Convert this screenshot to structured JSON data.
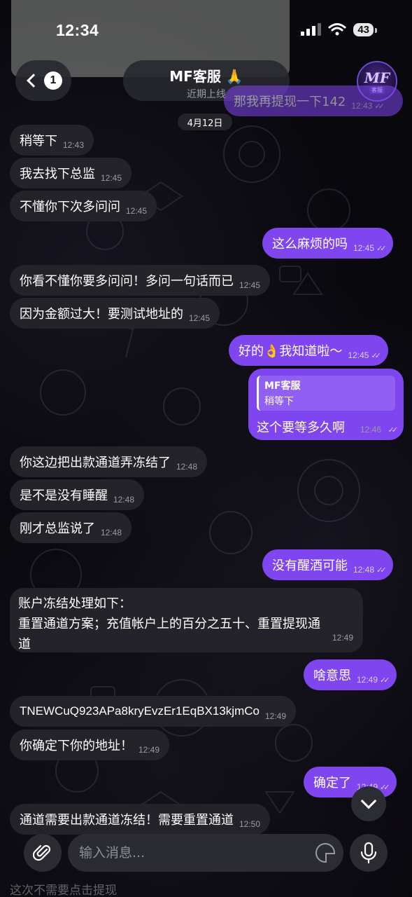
{
  "status_bar": {
    "time": "12:34",
    "battery": "43"
  },
  "header": {
    "back_badge": "1",
    "title": "MF客服 🙏",
    "subtitle": "近期上线",
    "avatar_logo": "MF",
    "avatar_tag": "客服"
  },
  "date_separator": "4月12日",
  "messages": [
    {
      "dir": "out",
      "text": "那我再提现一下142",
      "time": "12:43"
    },
    {
      "dir": "in",
      "text": "稍等下",
      "time": "12:43"
    },
    {
      "dir": "in",
      "text": "我去找下总监",
      "time": "12:45"
    },
    {
      "dir": "in",
      "text": "不懂你下次多问问",
      "time": "12:45"
    },
    {
      "dir": "out",
      "text": "这么麻烦的吗",
      "time": "12:45"
    },
    {
      "dir": "in",
      "text": "你看不懂你要多问问！多问一句话而已",
      "time": "12:45"
    },
    {
      "dir": "in",
      "text": "因为金额过大！要测试地址的",
      "time": "12:45"
    },
    {
      "dir": "out",
      "text": "好的👌我知道啦～",
      "time": "12:45"
    },
    {
      "dir": "out",
      "reply_to_name": "MF客服",
      "reply_to_text": "稍等下",
      "text": "这个要等多久啊",
      "time": "12:46"
    },
    {
      "dir": "in",
      "text": "你这边把出款通道弄冻结了",
      "time": "12:48"
    },
    {
      "dir": "in",
      "text": "是不是没有睡醒",
      "time": "12:48"
    },
    {
      "dir": "in",
      "text": "刚才总监说了",
      "time": "12:48"
    },
    {
      "dir": "out",
      "text": "没有醒酒可能",
      "time": "12:48"
    },
    {
      "dir": "in",
      "text_line1": "账户冻结处理如下：",
      "text_line2": "重置通道方案；充值帐户上的百分之五十、重置提现通",
      "text_line3": "道",
      "time": "12:49"
    },
    {
      "dir": "out",
      "text": "啥意思",
      "time": "12:49"
    },
    {
      "dir": "in",
      "text": "TNEWCuQ923APa8kryEvzEr1EqBX13kjmCo",
      "time": "12:49"
    },
    {
      "dir": "in",
      "text": "你确定下你的地址！",
      "time": "12:49"
    },
    {
      "dir": "out",
      "text": "确定了",
      "time": "12:49"
    },
    {
      "dir": "in",
      "text": "通道需要出款通道冻结！需要重置通道",
      "time": "12:50"
    },
    {
      "dir": "in",
      "text": "这次不需要点击提现"
    }
  ],
  "input": {
    "placeholder": "输入消息..."
  },
  "colors": {
    "outgoing_bubble": "#7f46f0",
    "incoming_bubble": "#232329",
    "background": "#09080d"
  },
  "icons": [
    "back-chevron-icon",
    "signal-icon",
    "wifi-icon",
    "battery-icon",
    "check-icon",
    "chevron-down-icon",
    "paperclip-icon",
    "sticker-icon",
    "microphone-icon"
  ]
}
